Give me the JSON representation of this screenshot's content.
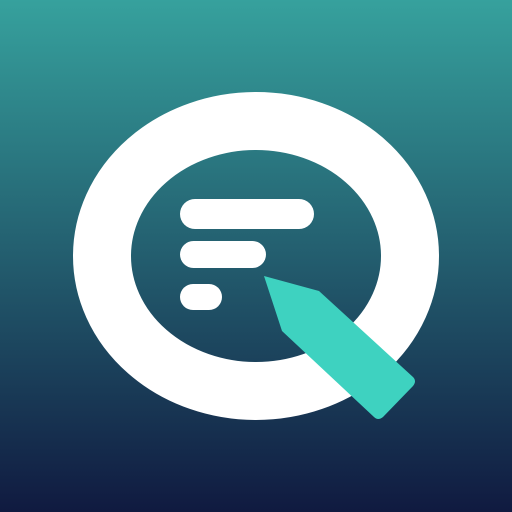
{
  "icon": {
    "name": "app-logo-q-with-pen",
    "colors": {
      "gradient_top": "#36a19d",
      "gradient_bottom": "#101a40",
      "ring": "#ffffff",
      "lines": "#ffffff",
      "pen": "#3ed2c0"
    }
  }
}
